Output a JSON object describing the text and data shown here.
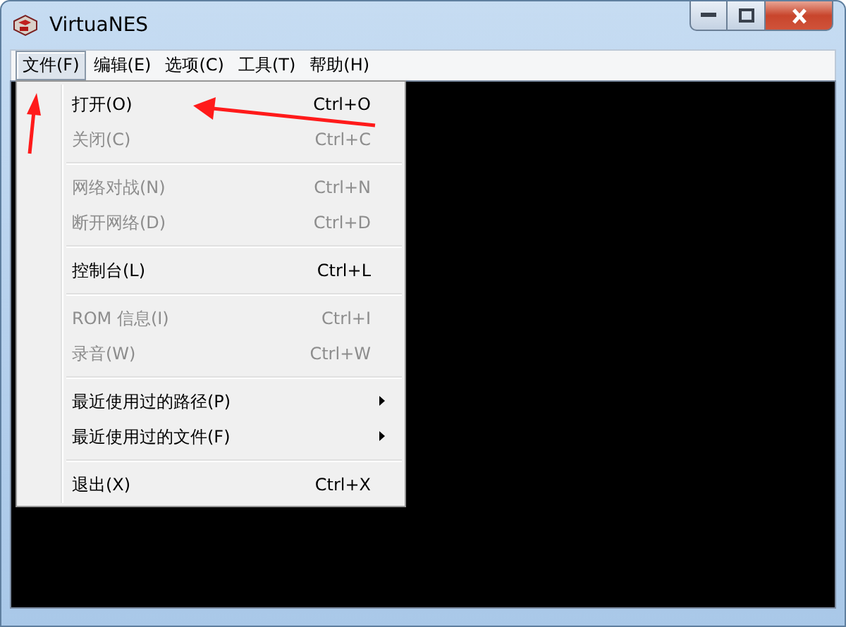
{
  "window": {
    "title": "VirtuaNES"
  },
  "menu_bar": [
    {
      "label": "文件(F)",
      "selected": true
    },
    {
      "label": "编辑(E)",
      "selected": false
    },
    {
      "label": "选项(C)",
      "selected": false
    },
    {
      "label": "工具(T)",
      "selected": false
    },
    {
      "label": "帮助(H)",
      "selected": false
    }
  ],
  "file_menu": [
    {
      "kind": "command",
      "label": "打开(O)",
      "shortcut": "Ctrl+O",
      "disabled": false
    },
    {
      "kind": "command",
      "label": "关闭(C)",
      "shortcut": "Ctrl+C",
      "disabled": true
    },
    {
      "kind": "separator"
    },
    {
      "kind": "command",
      "label": "网络对战(N)",
      "shortcut": "Ctrl+N",
      "disabled": true
    },
    {
      "kind": "command",
      "label": "断开网络(D)",
      "shortcut": "Ctrl+D",
      "disabled": true
    },
    {
      "kind": "separator"
    },
    {
      "kind": "command",
      "label": "控制台(L)",
      "shortcut": "Ctrl+L",
      "disabled": false
    },
    {
      "kind": "separator"
    },
    {
      "kind": "command",
      "label": "ROM 信息(I)",
      "shortcut": "Ctrl+I",
      "disabled": true
    },
    {
      "kind": "command",
      "label": "录音(W)",
      "shortcut": "Ctrl+W",
      "disabled": true
    },
    {
      "kind": "separator"
    },
    {
      "kind": "submenu",
      "label": "最近使用过的路径(P)",
      "disabled": false
    },
    {
      "kind": "submenu",
      "label": "最近使用过的文件(F)",
      "disabled": false
    },
    {
      "kind": "separator"
    },
    {
      "kind": "command",
      "label": "退出(X)",
      "shortcut": "Ctrl+X",
      "disabled": false
    }
  ]
}
